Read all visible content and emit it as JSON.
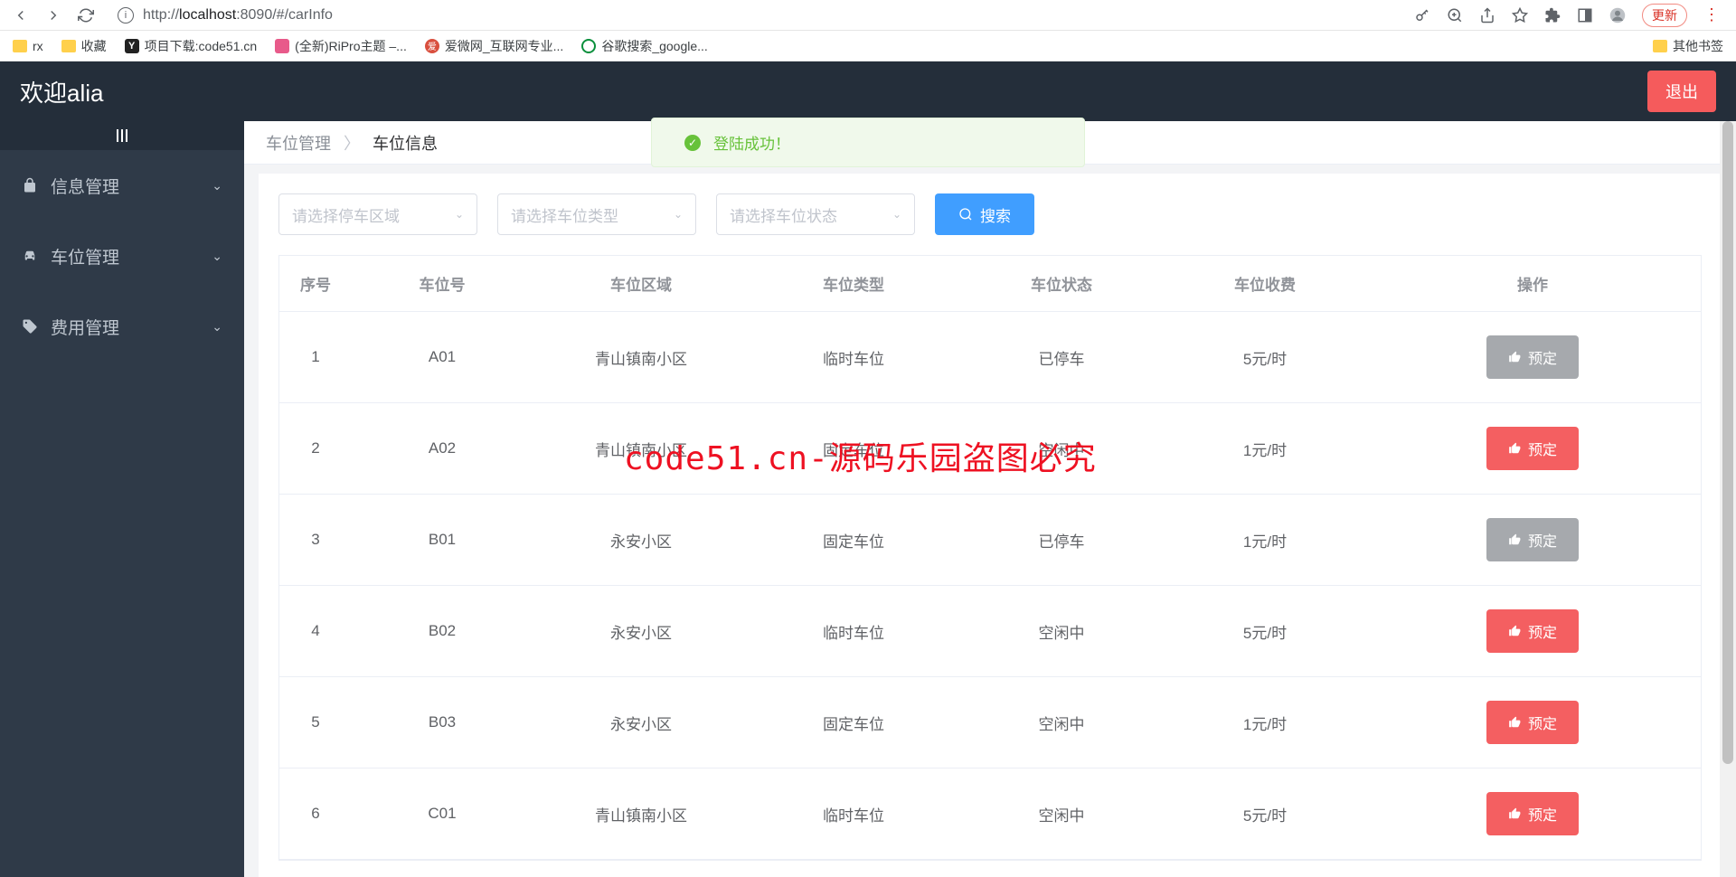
{
  "browser": {
    "url_prefix": "http://",
    "url_host": "localhost",
    "url_port": ":8090",
    "url_path": "/#/carInfo",
    "update_label": "更新"
  },
  "bookmarks": {
    "rx": "rx",
    "favorites": "收藏",
    "project": "项目下载:code51.cn",
    "ripro": "(全新)RiPro主题 –...",
    "aiwei": "爱微网_互联网专业...",
    "google": "谷歌搜索_google...",
    "other": "其他书签"
  },
  "header": {
    "welcome": "欢迎alia",
    "logout": "退出"
  },
  "sidebar": {
    "items": [
      {
        "label": "信息管理"
      },
      {
        "label": "车位管理"
      },
      {
        "label": "费用管理"
      }
    ]
  },
  "breadcrumb": {
    "root": "车位管理",
    "current": "车位信息"
  },
  "filters": {
    "area_placeholder": "请选择停车区域",
    "type_placeholder": "请选择车位类型",
    "status_placeholder": "请选择车位状态",
    "search_label": "搜索"
  },
  "table": {
    "headers": {
      "idx": "序号",
      "num": "车位号",
      "area": "车位区域",
      "type": "车位类型",
      "status": "车位状态",
      "fee": "车位收费",
      "action": "操作"
    },
    "rows": [
      {
        "idx": "1",
        "num": "A01",
        "area": "青山镇南小区",
        "type": "临时车位",
        "status": "已停车",
        "fee": "5元/时",
        "action": "预定",
        "disabled": true
      },
      {
        "idx": "2",
        "num": "A02",
        "area": "青山镇南小区",
        "type": "固定车位",
        "status": "空闲中",
        "fee": "1元/时",
        "action": "预定",
        "disabled": false
      },
      {
        "idx": "3",
        "num": "B01",
        "area": "永安小区",
        "type": "固定车位",
        "status": "已停车",
        "fee": "1元/时",
        "action": "预定",
        "disabled": true
      },
      {
        "idx": "4",
        "num": "B02",
        "area": "永安小区",
        "type": "临时车位",
        "status": "空闲中",
        "fee": "5元/时",
        "action": "预定",
        "disabled": false
      },
      {
        "idx": "5",
        "num": "B03",
        "area": "永安小区",
        "type": "固定车位",
        "status": "空闲中",
        "fee": "1元/时",
        "action": "预定",
        "disabled": false
      },
      {
        "idx": "6",
        "num": "C01",
        "area": "青山镇南小区",
        "type": "临时车位",
        "status": "空闲中",
        "fee": "5元/时",
        "action": "预定",
        "disabled": false
      }
    ]
  },
  "toast": {
    "message": "登陆成功！"
  },
  "watermark": "code51.cn-源码乐园盗图必究"
}
